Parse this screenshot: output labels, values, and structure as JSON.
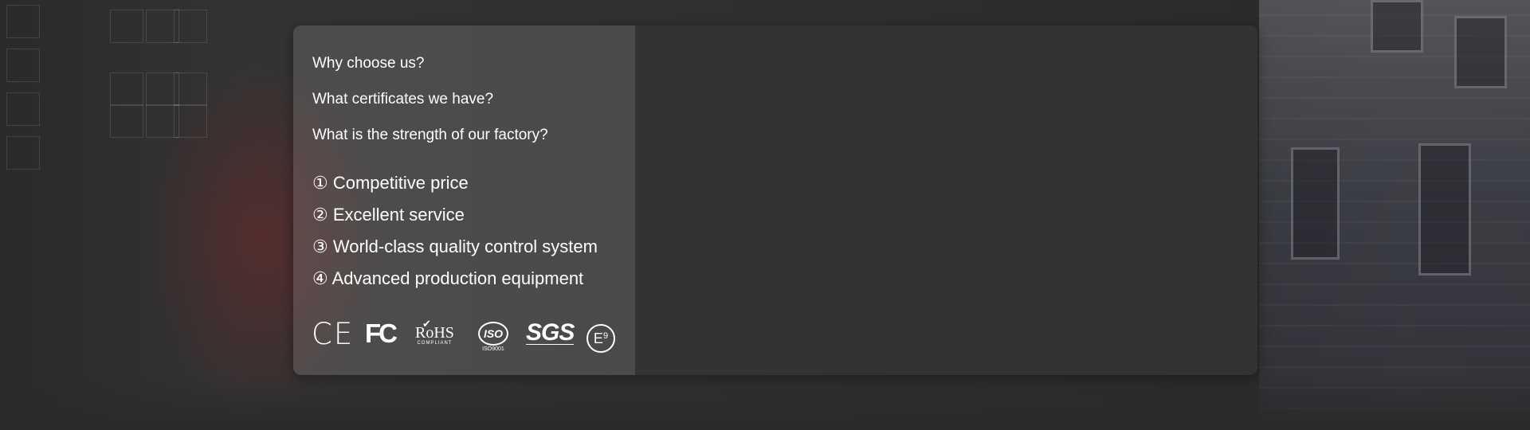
{
  "questions": [
    {
      "label": "Why choose us?"
    },
    {
      "label": "What certificates we have?"
    },
    {
      "label": "What is the strength of our factory?"
    }
  ],
  "features": [
    {
      "label": "① Competitive price"
    },
    {
      "label": "② Excellent service"
    },
    {
      "label": "③ World-class quality control system"
    },
    {
      "label": "④ Advanced production equipment"
    }
  ],
  "certifications": {
    "ce": "CE",
    "fc": "FC",
    "rohs": "RoHS",
    "rohs_sub": "COMPLIANT",
    "iso": "ISO",
    "iso_sub": "ISO9001",
    "sgs": "SGS",
    "e": "E",
    "e_num": "9"
  },
  "video": {
    "play_icon": "play-circle-icon"
  },
  "colors": {
    "panel_bg": "#333333",
    "text": "#ffffff"
  }
}
